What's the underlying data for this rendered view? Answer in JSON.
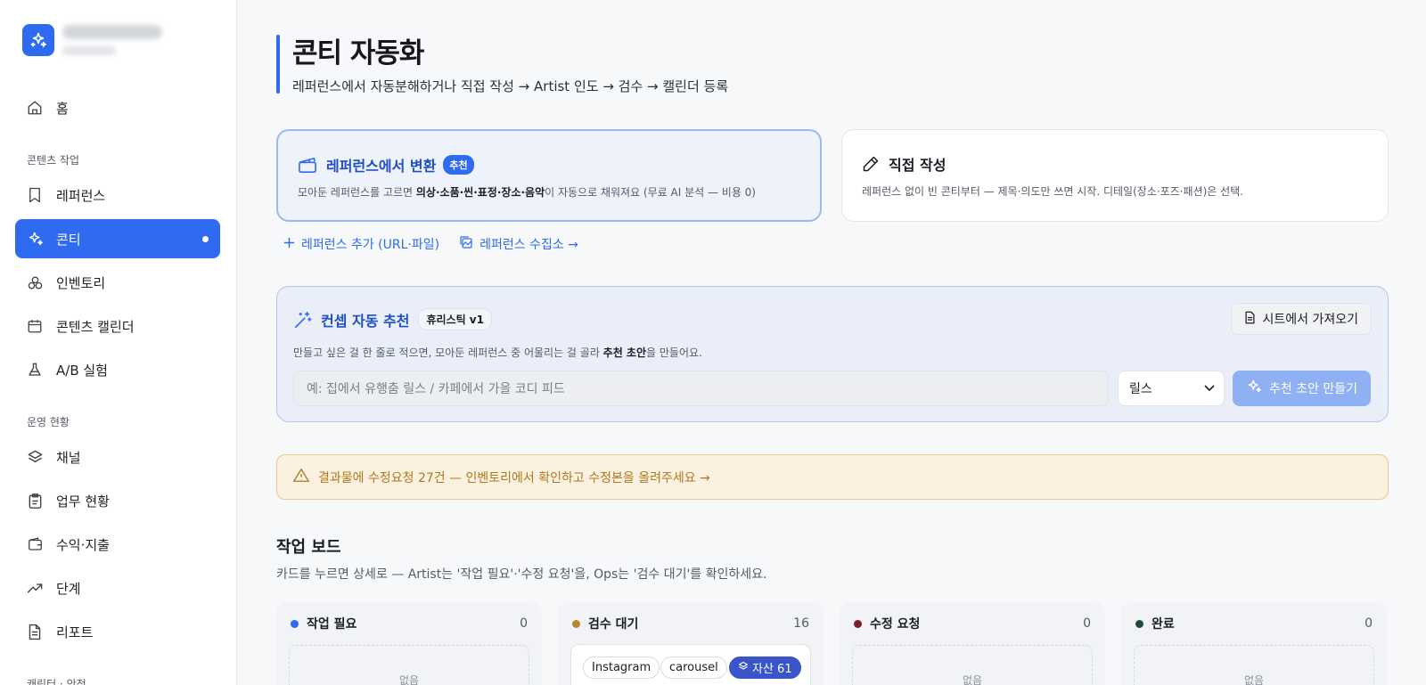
{
  "sidebar": {
    "home": "홈",
    "sections": {
      "content": "콘텐츠 작업",
      "ops": "운영 현황",
      "bottom": "캐릭터 · 안전"
    },
    "items": [
      {
        "label": "레퍼런스"
      },
      {
        "label": "콘티"
      },
      {
        "label": "인벤토리"
      },
      {
        "label": "콘텐츠 캘린더"
      },
      {
        "label": "A/B 실험"
      },
      {
        "label": "채널"
      },
      {
        "label": "업무 현황"
      },
      {
        "label": "수익·지출"
      },
      {
        "label": "단계"
      },
      {
        "label": "리포트"
      }
    ]
  },
  "header": {
    "title": "콘티 자동화",
    "subtitle": "레퍼런스에서 자동분해하거나 직접 작성 → Artist 인도 → 검수 → 캘린더 등록"
  },
  "cards": {
    "ref": {
      "title": "레퍼런스에서 변환",
      "badge": "추천",
      "desc_pre": "모아둔 레퍼런스를 고르면 ",
      "desc_bold": "의상·소품·씬·표정·장소·음악",
      "desc_post": "이 자동으로 채워져요 (무료 AI 분석 — 비용 0)"
    },
    "direct": {
      "title": "직접 작성",
      "desc": "레퍼런스 없이 빈 콘티부터 — 제목·의도만 쓰면 시작. 디테일(장소·포즈·패션)은 선택."
    }
  },
  "links": {
    "add_ref": "레퍼런스 추가 (URL·파일)",
    "collection": "레퍼런스 수집소 →"
  },
  "concept": {
    "title": "컨셉 자동 추천",
    "chip": "휴리스틱 v1",
    "sheet_button": "시트에서 가져오기",
    "desc_pre": "만들고 싶은 걸 한 줄로 적으면, 모아둔 레퍼런스 중 어울리는 걸 골라 ",
    "desc_bold": "추천 초안",
    "desc_post": "을 만들어요.",
    "input_placeholder": "예: 집에서 유행춤 릴스 / 카페에서 가을 코디 피드",
    "format_selected": "릴스",
    "make_button": "추천 초안 만들기"
  },
  "warning": {
    "text": "결과물에 수정요청 27건 — 인벤토리에서 확인하고 수정본을 올려주세요 →"
  },
  "board": {
    "title": "작업 보드",
    "subtitle": "카드를 누르면 상세로 — Artist는 '작업 필요'·'수정 요청'을, Ops는 '검수 대기'를 확인하세요.",
    "columns": [
      {
        "label": "작업 필요",
        "count": "0",
        "empty": "없음",
        "color": "#2f6bf0"
      },
      {
        "label": "검수 대기",
        "count": "16",
        "color": "#b8862b",
        "card": {
          "tags": [
            "Instagram",
            "carousel"
          ],
          "asset": "자산 61"
        }
      },
      {
        "label": "수정 요청",
        "count": "0",
        "empty": "없음",
        "color": "#7a1f2b"
      },
      {
        "label": "완료",
        "count": "0",
        "empty": "없음",
        "color": "#1f4a34"
      }
    ]
  },
  "colors": {
    "accent": "#2f6bf0",
    "warning": "#b0781b"
  }
}
